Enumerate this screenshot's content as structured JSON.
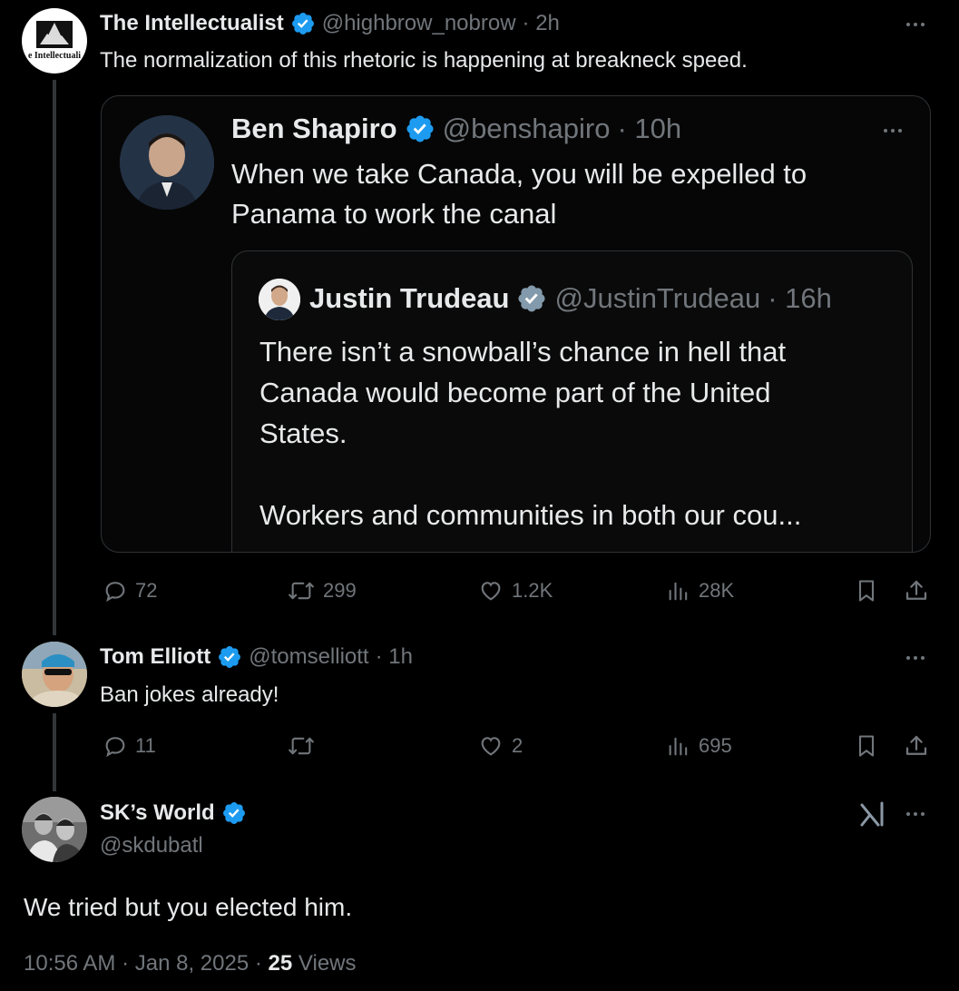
{
  "colors": {
    "verified": "#1d9bf0",
    "muted": "#71767b",
    "text": "#e7e9ea",
    "border": "#2f3336"
  },
  "tweet1": {
    "name": "The Intellectualist",
    "handle": "@highbrow_nobrow",
    "time": "· 2h",
    "text": "The normalization of this rhetoric is happening at breakneck speed.",
    "avatar_text": "e Intellectuali",
    "quoted": {
      "name": "Ben Shapiro",
      "handle": "@benshapiro",
      "time": "· 10h",
      "text_line1": "When we take Canada, you will be expelled to",
      "text_line2": "Panama to work the canal",
      "inner": {
        "name": "Justin Trudeau",
        "handle": "@JustinTrudeau",
        "time": "· 16h",
        "text_line1": "There isn’t a snowball’s chance in hell that",
        "text_line2": "Canada would become part of the United",
        "text_line3": "States.",
        "text_line4": "Workers and communities in both our cou..."
      }
    },
    "actions": {
      "replies": "72",
      "retweets": "299",
      "likes": "1.2K",
      "views": "28K"
    }
  },
  "tweet2": {
    "name": "Tom Elliott",
    "handle": "@tomselliott",
    "time": "· 1h",
    "text": "Ban jokes already!",
    "actions": {
      "replies": "11",
      "retweets": "",
      "likes": "2",
      "views": "695"
    }
  },
  "tweet3": {
    "name": "SK’s World",
    "handle": "@skdubatl",
    "text": "We tried but you elected him.",
    "grok_icon": "grok-icon",
    "footer": {
      "time": "10:56 AM",
      "date": "Jan 8, 2025",
      "views_count": "25",
      "views_label": "Views"
    }
  }
}
